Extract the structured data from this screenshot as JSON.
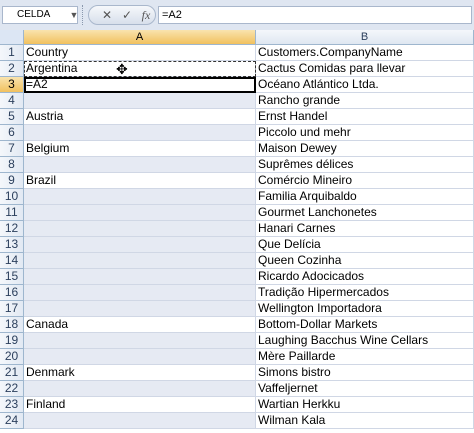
{
  "name_box": {
    "value": "CELDA"
  },
  "formula_bar": {
    "cancel_icon": "✕",
    "enter_icon": "✓",
    "function_icon": "fx",
    "value": "=A2"
  },
  "columns": [
    "A",
    "B"
  ],
  "rows": [
    {
      "num": "1",
      "a": "Country",
      "b": "Customers.CompanyName"
    },
    {
      "num": "2",
      "a": "Argentina",
      "b": "Cactus Comidas para llevar"
    },
    {
      "num": "3",
      "a": "=A2",
      "b": "Océano Atlántico Ltda."
    },
    {
      "num": "4",
      "a": "",
      "b": "Rancho grande"
    },
    {
      "num": "5",
      "a": "Austria",
      "b": "Ernst Handel"
    },
    {
      "num": "6",
      "a": "",
      "b": "Piccolo und mehr"
    },
    {
      "num": "7",
      "a": "Belgium",
      "b": "Maison Dewey"
    },
    {
      "num": "8",
      "a": "",
      "b": "Suprêmes délices"
    },
    {
      "num": "9",
      "a": "Brazil",
      "b": "Comércio Mineiro"
    },
    {
      "num": "10",
      "a": "",
      "b": "Familia Arquibaldo"
    },
    {
      "num": "11",
      "a": "",
      "b": "Gourmet Lanchonetes"
    },
    {
      "num": "12",
      "a": "",
      "b": "Hanari Carnes"
    },
    {
      "num": "13",
      "a": "",
      "b": "Que Delícia"
    },
    {
      "num": "14",
      "a": "",
      "b": "Queen Cozinha"
    },
    {
      "num": "15",
      "a": "",
      "b": "Ricardo Adocicados"
    },
    {
      "num": "16",
      "a": "",
      "b": "Tradição Hipermercados"
    },
    {
      "num": "17",
      "a": "",
      "b": "Wellington Importadora"
    },
    {
      "num": "18",
      "a": "Canada",
      "b": "Bottom-Dollar Markets"
    },
    {
      "num": "19",
      "a": "",
      "b": "Laughing Bacchus Wine Cellars"
    },
    {
      "num": "20",
      "a": "",
      "b": "Mère Paillarde"
    },
    {
      "num": "21",
      "a": "Denmark",
      "b": "Simons bistro"
    },
    {
      "num": "22",
      "a": "",
      "b": "Vaffeljernet"
    },
    {
      "num": "23",
      "a": "Finland",
      "b": "Wartian Herkku"
    },
    {
      "num": "24",
      "a": "",
      "b": "Wilman Kala"
    }
  ]
}
